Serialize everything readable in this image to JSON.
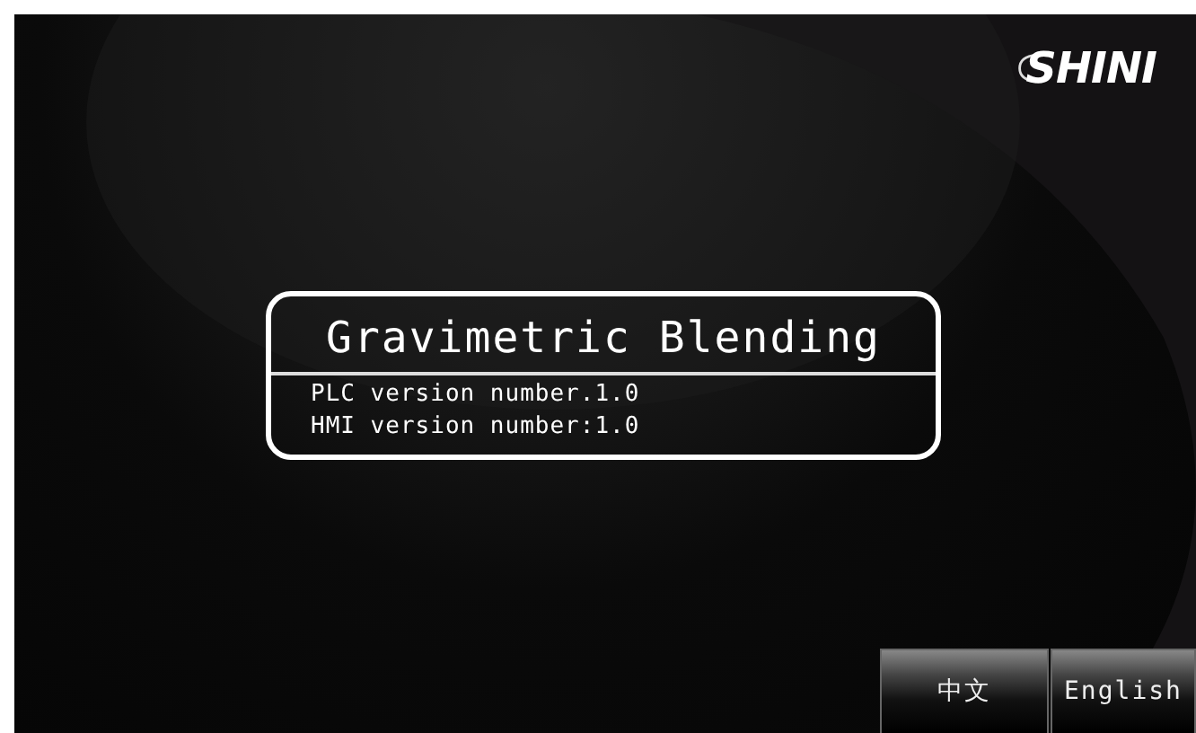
{
  "logo": {
    "text": "SHINI"
  },
  "info_panel": {
    "title": "Gravimetric Blending",
    "lines": [
      "PLC version number.1.0",
      "HMI version number:1.0"
    ]
  },
  "language_buttons": [
    {
      "label": "中文",
      "selected": false
    },
    {
      "label": "English",
      "selected": false
    }
  ]
}
